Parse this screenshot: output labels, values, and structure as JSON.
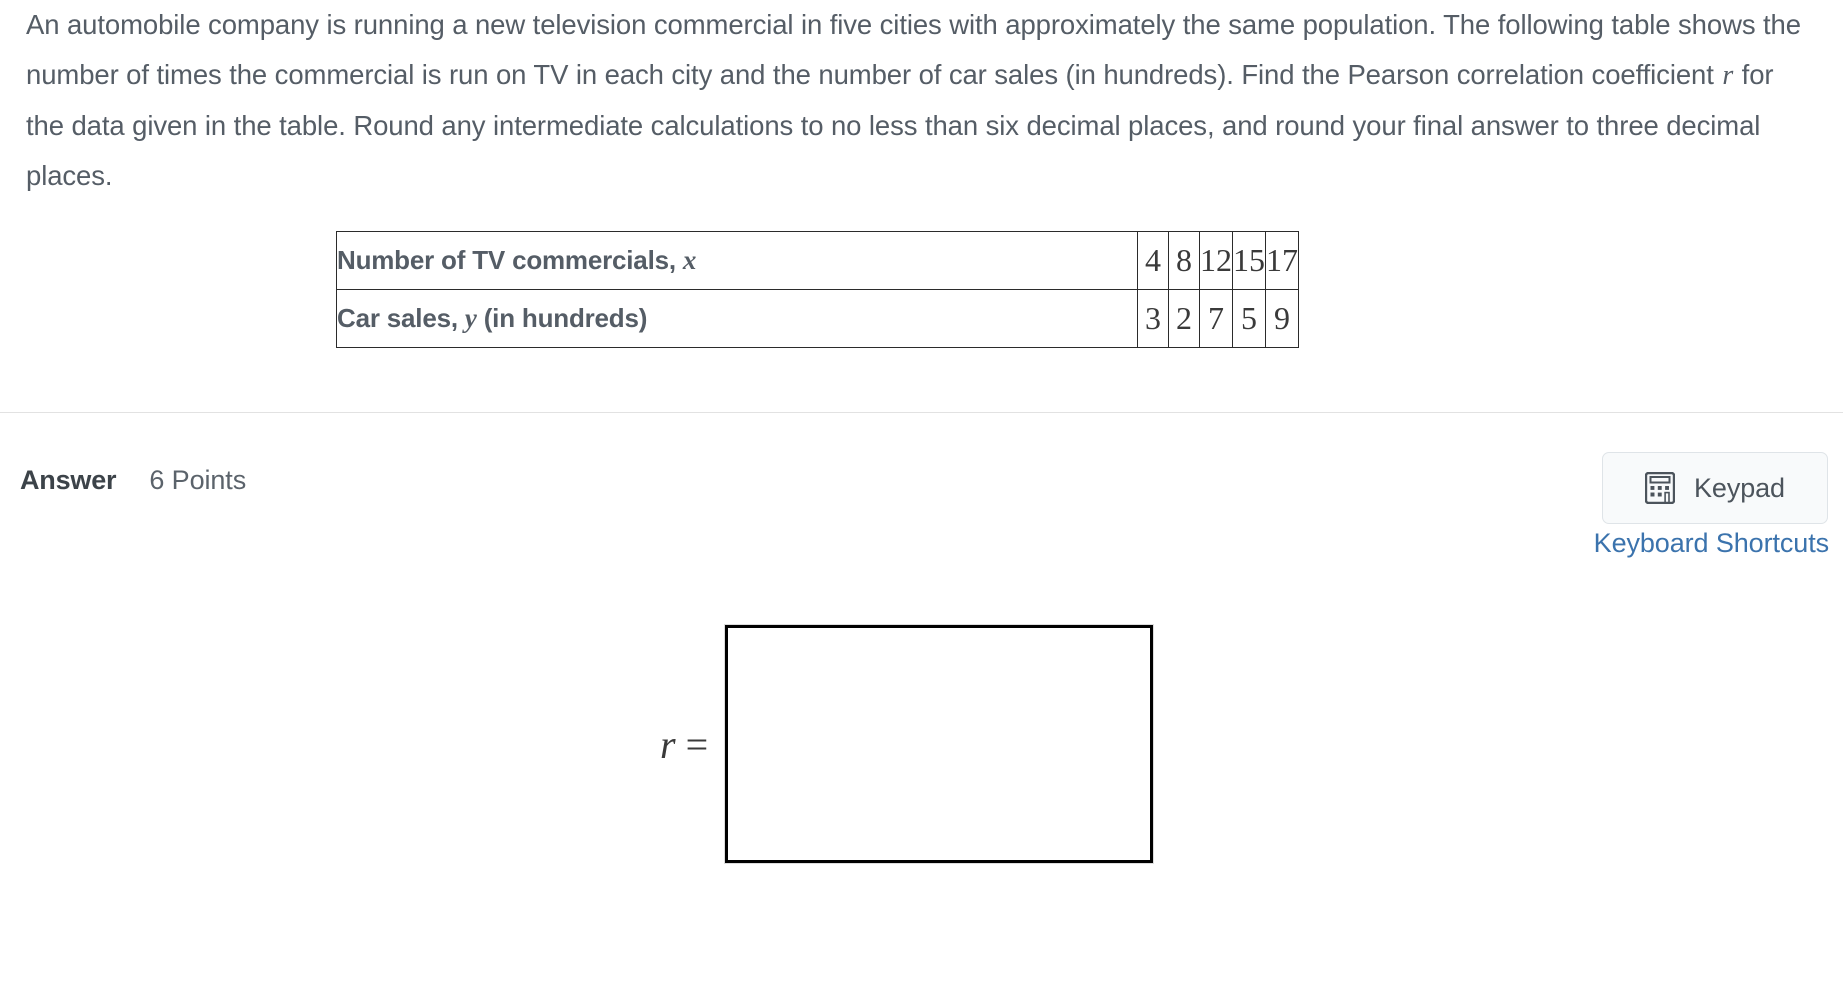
{
  "question": {
    "segments": [
      {
        "type": "text",
        "value": "An automobile company is running a new television commercial in five cities with approximately the same population. The following table shows the number of times the commercial is run on TV in each city and the number of car sales (in hundreds). Find the Pearson correlation coefficient "
      },
      {
        "type": "math",
        "value": "r"
      },
      {
        "type": "text",
        "value": " for the data given in the table. Round any intermediate calculations to no less than six decimal places, and round your final answer to three decimal places."
      }
    ],
    "part1": "An automobile company is running a new television commercial in five cities with approximately the same population. The following table shows the number of times the commercial is run on TV in each city and the number of car sales (in hundreds). Find the Pearson correlation coefficient ",
    "math_var": "r",
    "part2": " for the data given in the table. Round any intermediate calculations to no less than six decimal places, and round your final answer to three decimal places."
  },
  "table": {
    "rows": [
      {
        "label_prefix": "Number of TV commercials, ",
        "label_var": "x",
        "label_suffix": "",
        "values": [
          "4",
          "8",
          "12",
          "15",
          "17"
        ]
      },
      {
        "label_prefix": "Car sales, ",
        "label_var": "y",
        "label_suffix": " (in hundreds)",
        "values": [
          "3",
          "2",
          "7",
          "5",
          "9"
        ]
      }
    ]
  },
  "answer_section": {
    "title": "Answer",
    "points": "6 Points",
    "keypad_label": "Keypad",
    "keypad_icon": "calculator-icon",
    "keyboard_shortcuts_label": "Keyboard Shortcuts",
    "answer_prefix_var": "r",
    "answer_prefix_eq": " =",
    "answer_value": "",
    "answer_placeholder": ""
  },
  "colors": {
    "text": "#555d66",
    "link": "#3b73ad",
    "border": "#2b2b2b",
    "divider": "#e2e2e2",
    "button_bg": "#f8fafb"
  }
}
